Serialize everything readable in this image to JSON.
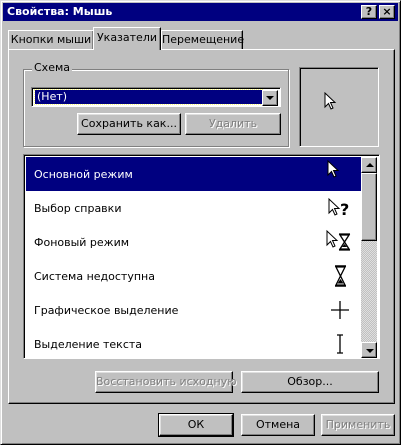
{
  "window": {
    "title": "Свойства: Мышь",
    "help_button": "?",
    "close_button": "×"
  },
  "tabs": [
    {
      "label": "Кнопки мыши",
      "active": false
    },
    {
      "label": "Указатели",
      "active": true
    },
    {
      "label": "Перемещение",
      "active": false
    }
  ],
  "scheme": {
    "group_label": "Схема",
    "selected_value": "(Нет)",
    "save_as_label": "Сохранить как...",
    "delete_label": "Удалить"
  },
  "preview": {
    "icon": "arrow-pointer-icon"
  },
  "pointers": [
    {
      "label": "Основной режим",
      "icon": "arrow-pointer-icon",
      "selected": true
    },
    {
      "label": "Выбор справки",
      "icon": "help-select-icon",
      "selected": false
    },
    {
      "label": "Фоновый режим",
      "icon": "working-in-background-icon",
      "selected": false
    },
    {
      "label": "Система недоступна",
      "icon": "hourglass-busy-icon",
      "selected": false
    },
    {
      "label": "Графическое выделение",
      "icon": "crosshair-icon",
      "selected": false
    },
    {
      "label": "Выделение текста",
      "icon": "text-ibeam-icon",
      "selected": false
    }
  ],
  "list_buttons": {
    "restore_default_label": "Восстановить исходную",
    "browse_label": "Обзор..."
  },
  "dialog_buttons": {
    "ok_label": "ОК",
    "cancel_label": "Отмена",
    "apply_label": "Применить"
  },
  "colors": {
    "face": "#c0c0c0",
    "title_bar": "#000080",
    "selection": "#000080"
  }
}
